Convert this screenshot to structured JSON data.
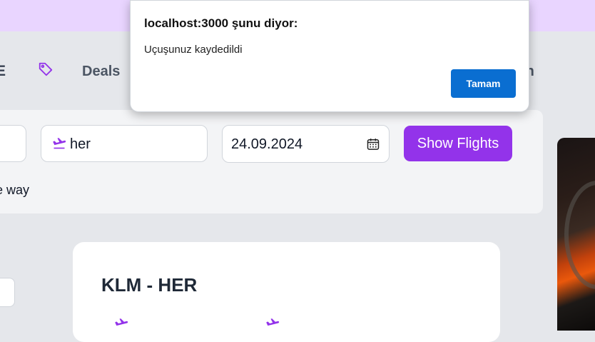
{
  "nav": {
    "left_partial": "E",
    "deals_label": "Deals",
    "right_partial": "th"
  },
  "search": {
    "to_value": "her",
    "date_value": "24.09.2024",
    "show_flights_label": "Show Flights",
    "trip_type_partial": "e way"
  },
  "card": {
    "title": "KLM - HER"
  },
  "dialog": {
    "title": "localhost:3000 şunu diyor:",
    "message": "Uçuşunuz kaydedildi",
    "ok_label": "Tamam"
  },
  "colors": {
    "accent": "#9333ea",
    "topbar": "#e9d5ff",
    "dialog_button": "#0a6ed1"
  },
  "icons": [
    "tag-icon",
    "plane-landing-icon",
    "calendar-icon",
    "plane-icon"
  ]
}
